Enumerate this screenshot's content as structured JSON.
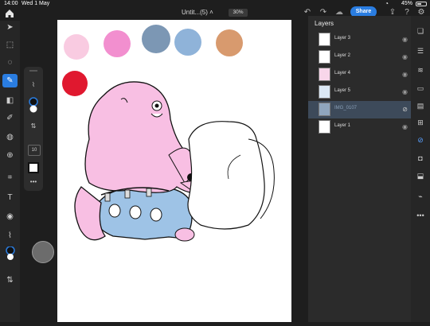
{
  "status_bar": {
    "time": "14:00",
    "date": "Wed 1 May",
    "battery": "45%"
  },
  "header": {
    "title": "Untit...(5)",
    "zoom": "30%",
    "share_label": "Share"
  },
  "layers": {
    "title": "Layers",
    "items": [
      {
        "name": "Layer 3"
      },
      {
        "name": "Layer 2"
      },
      {
        "name": "Layer 4"
      },
      {
        "name": "Layer 5"
      },
      {
        "name": "IMG_0107",
        "selected": true
      },
      {
        "name": "Layer 1"
      }
    ]
  },
  "brush_panel": {
    "size": "10"
  },
  "colors": {
    "accent": "#2a7de1",
    "palette": [
      "#f9cbe1",
      "#f28fcf",
      "#7c97b4",
      "#8fb3d9",
      "#d89a6e",
      "#e0182f"
    ],
    "figure_pink": "#f8bfe3",
    "figure_blue": "#9ec3e6"
  },
  "icons": {
    "left_tools": [
      "move",
      "transform",
      "lasso",
      "brush",
      "eraser",
      "pencil",
      "fill",
      "clone",
      "crop",
      "text",
      "adjust",
      "eyedropper",
      "color",
      "swap"
    ],
    "right_tools": [
      "layers",
      "adjustments",
      "properties",
      "comments",
      "layer-properties",
      "add-layer",
      "visibility",
      "mask",
      "clip",
      "fx",
      "more"
    ]
  }
}
